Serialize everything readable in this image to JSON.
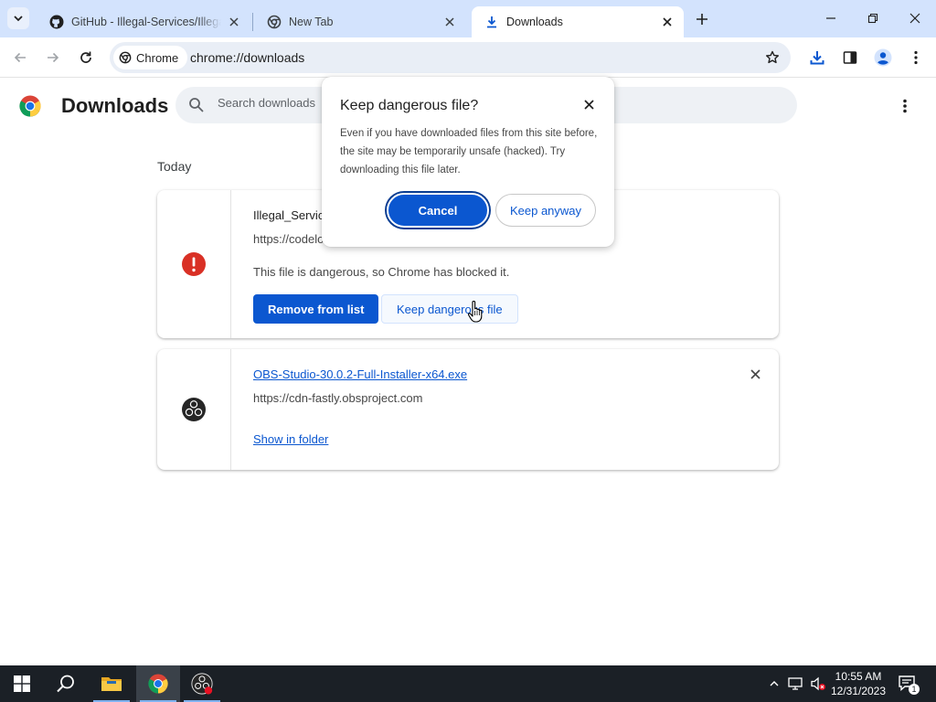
{
  "browser": {
    "tabs": [
      {
        "title": "GitHub - Illegal-Services/Illegal_Services",
        "icon": "github-icon",
        "active": false
      },
      {
        "title": "New Tab",
        "icon": "chrome-newtab-icon",
        "active": false
      },
      {
        "title": "Downloads",
        "icon": "download-icon",
        "active": true
      }
    ],
    "chip_label": "Chrome",
    "url": "chrome://downloads"
  },
  "page": {
    "title": "Downloads",
    "search_placeholder": "Search downloads",
    "section_label": "Today"
  },
  "downloads": [
    {
      "file_name": "Illegal_Servic",
      "source_url": "https://codelo",
      "status": "This file is dangerous, so Chrome has blocked it.",
      "remove_label": "Remove from list",
      "keep_label": "Keep dangerous file",
      "icon": "warning-icon"
    },
    {
      "file_name": "OBS-Studio-30.0.2-Full-Installer-x64.exe",
      "source_url": "https://cdn-fastly.obsproject.com",
      "show_in_folder": "Show in folder",
      "icon": "obs-icon"
    }
  ],
  "dialog": {
    "title": "Keep dangerous file?",
    "body": "Even if you have downloaded files from this site before, the site may be temporarily unsafe (hacked). Try downloading this file later.",
    "cancel_label": "Cancel",
    "keep_label": "Keep anyway"
  },
  "taskbar": {
    "time": "10:55 AM",
    "date": "12/31/2023",
    "notification_count": "1"
  },
  "colors": {
    "accent": "#0b57d0",
    "danger": "#d93025",
    "tabstrip": "#d3e3fd",
    "taskbar": "#1b2026"
  }
}
